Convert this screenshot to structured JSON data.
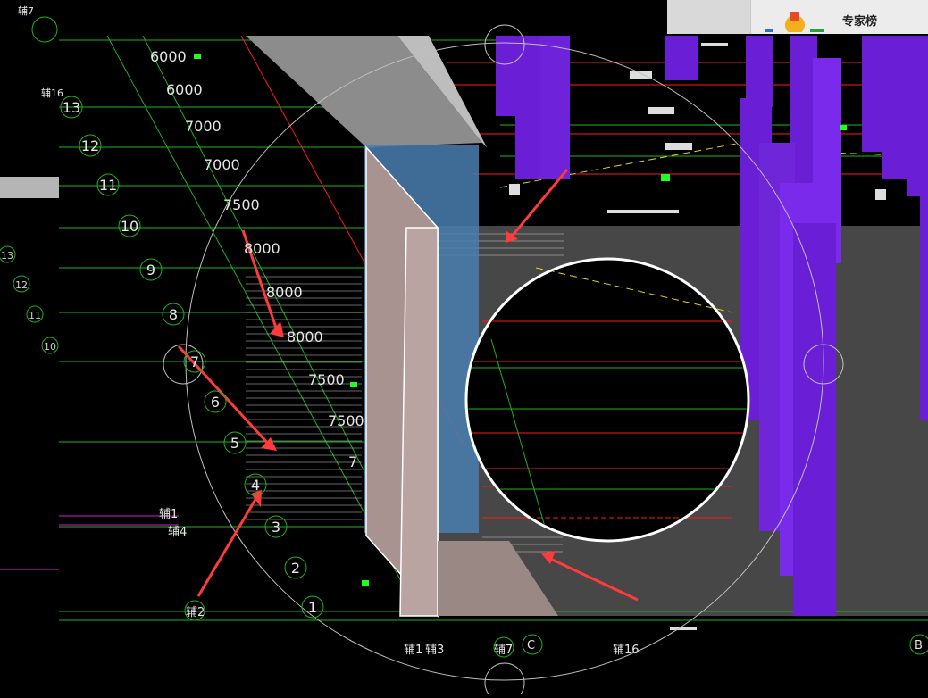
{
  "toolbar": {
    "experts_label": "专家榜",
    "icon": "experts-trophy-icon"
  },
  "colors": {
    "background": "#000000",
    "grid_green": "#20c020",
    "axis_white": "#e6e6e6",
    "red_line": "#ff1a1a",
    "purple_column": "#6a1fd6",
    "wall_gray": "#8c8c8c",
    "panel_blue": "#4a7fb0",
    "pink_wall": "#a89390",
    "arrow_red": "#ff3b3b"
  },
  "dimensions": [
    "6000",
    "6000",
    "7000",
    "7000",
    "7500",
    "8000",
    "8000",
    "8000",
    "7500",
    "7500",
    "7"
  ],
  "axis_circles": [
    "13",
    "12",
    "11",
    "10",
    "9",
    "8",
    "7",
    "6",
    "5",
    "4",
    "3",
    "2",
    "1"
  ],
  "left_axis_circles": [
    "13",
    "12",
    "11",
    "10"
  ],
  "aux_labels": {
    "top_left": "辅7",
    "left_aux": "辅16",
    "aux1": "辅1",
    "aux4": "辅4",
    "aux2": "辅2",
    "bottom_a": "辅1",
    "bottom_b": "辅3",
    "bottom_c": "辅7",
    "bottom_d": "辅16",
    "bottom_e": "C",
    "bottom_right": "B"
  }
}
